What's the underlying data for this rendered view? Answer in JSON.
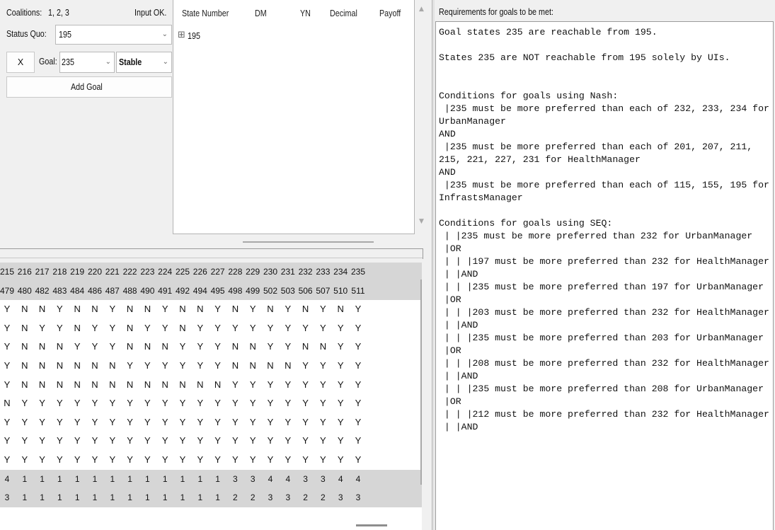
{
  "controls": {
    "coalitions_label": "Coalitions:",
    "coalitions_value": "1, 2, 3",
    "input_status": "Input OK.",
    "status_quo_label": "Status Quo:",
    "status_quo_value": "195",
    "remove_button": "X",
    "goal_label": "Goal:",
    "goal_value": "235",
    "stability_value": "Stable",
    "add_goal_button": "Add Goal"
  },
  "tree": {
    "columns": [
      "State Number",
      "DM",
      "YN",
      "Decimal",
      "Payoff"
    ],
    "expand_glyph": "⊞",
    "root_node": "195"
  },
  "grid": {
    "header_rows": [
      [
        "215",
        "216",
        "217",
        "218",
        "219",
        "220",
        "221",
        "222",
        "223",
        "224",
        "225",
        "226",
        "227",
        "228",
        "229",
        "230",
        "231",
        "232",
        "233",
        "234",
        "235"
      ],
      [
        "479",
        "480",
        "482",
        "483",
        "484",
        "486",
        "487",
        "488",
        "490",
        "491",
        "492",
        "494",
        "495",
        "498",
        "499",
        "502",
        "503",
        "506",
        "507",
        "510",
        "511"
      ]
    ],
    "yn_rows": [
      [
        "Y",
        "N",
        "N",
        "Y",
        "N",
        "N",
        "Y",
        "N",
        "N",
        "Y",
        "N",
        "N",
        "Y",
        "N",
        "Y",
        "N",
        "Y",
        "N",
        "Y",
        "N",
        "Y"
      ],
      [
        "Y",
        "N",
        "Y",
        "Y",
        "N",
        "Y",
        "Y",
        "N",
        "Y",
        "Y",
        "N",
        "Y",
        "Y",
        "Y",
        "Y",
        "Y",
        "Y",
        "Y",
        "Y",
        "Y",
        "Y"
      ],
      [
        "Y",
        "N",
        "N",
        "N",
        "Y",
        "Y",
        "Y",
        "N",
        "N",
        "N",
        "Y",
        "Y",
        "Y",
        "N",
        "N",
        "Y",
        "Y",
        "N",
        "N",
        "Y",
        "Y"
      ],
      [
        "Y",
        "N",
        "N",
        "N",
        "N",
        "N",
        "N",
        "Y",
        "Y",
        "Y",
        "Y",
        "Y",
        "Y",
        "N",
        "N",
        "N",
        "N",
        "Y",
        "Y",
        "Y",
        "Y"
      ],
      [
        "Y",
        "N",
        "N",
        "N",
        "N",
        "N",
        "N",
        "N",
        "N",
        "N",
        "N",
        "N",
        "N",
        "Y",
        "Y",
        "Y",
        "Y",
        "Y",
        "Y",
        "Y",
        "Y"
      ],
      [
        "N",
        "Y",
        "Y",
        "Y",
        "Y",
        "Y",
        "Y",
        "Y",
        "Y",
        "Y",
        "Y",
        "Y",
        "Y",
        "Y",
        "Y",
        "Y",
        "Y",
        "Y",
        "Y",
        "Y",
        "Y"
      ],
      [
        "Y",
        "Y",
        "Y",
        "Y",
        "Y",
        "Y",
        "Y",
        "Y",
        "Y",
        "Y",
        "Y",
        "Y",
        "Y",
        "Y",
        "Y",
        "Y",
        "Y",
        "Y",
        "Y",
        "Y",
        "Y"
      ],
      [
        "Y",
        "Y",
        "Y",
        "Y",
        "Y",
        "Y",
        "Y",
        "Y",
        "Y",
        "Y",
        "Y",
        "Y",
        "Y",
        "Y",
        "Y",
        "Y",
        "Y",
        "Y",
        "Y",
        "Y",
        "Y"
      ],
      [
        "Y",
        "Y",
        "Y",
        "Y",
        "Y",
        "Y",
        "Y",
        "Y",
        "Y",
        "Y",
        "Y",
        "Y",
        "Y",
        "Y",
        "Y",
        "Y",
        "Y",
        "Y",
        "Y",
        "Y",
        "Y"
      ]
    ],
    "footer_rows": [
      [
        "4",
        "1",
        "1",
        "1",
        "1",
        "1",
        "1",
        "1",
        "1",
        "1",
        "1",
        "1",
        "1",
        "3",
        "3",
        "4",
        "4",
        "3",
        "3",
        "4",
        "4"
      ],
      [
        "3",
        "1",
        "1",
        "1",
        "1",
        "1",
        "1",
        "1",
        "1",
        "1",
        "1",
        "1",
        "1",
        "2",
        "2",
        "3",
        "3",
        "2",
        "2",
        "3",
        "3"
      ]
    ]
  },
  "requirements": {
    "label": "Requirements for goals to be met:",
    "lines": [
      "Goal states 235 are reachable from 195.",
      "",
      "States 235 are NOT reachable from 195 solely by UIs.",
      "",
      "",
      "Conditions for goals using Nash:",
      " |235 must be more preferred than each of 232, 233, 234 for UrbanManager",
      "AND",
      " |235 must be more preferred than each of 201, 207, 211, 215, 221, 227, 231 for HealthManager",
      "AND",
      " |235 must be more preferred than each of 115, 155, 195 for InfrastsManager",
      "",
      "Conditions for goals using SEQ:",
      " | |235 must be more preferred than 232 for UrbanManager",
      " |OR",
      " | | |197 must be more preferred than 232 for HealthManager",
      " | |AND",
      " | | |235 must be more preferred than 197 for UrbanManager",
      " |OR",
      " | | |203 must be more preferred than 232 for HealthManager",
      " | |AND",
      " | | |235 must be more preferred than 203 for UrbanManager",
      " |OR",
      " | | |208 must be more preferred than 232 for HealthManager",
      " | |AND",
      " | | |235 must be more preferred than 208 for UrbanManager",
      " |OR",
      " | | |212 must be more preferred than 232 for HealthManager",
      " | |AND"
    ]
  }
}
